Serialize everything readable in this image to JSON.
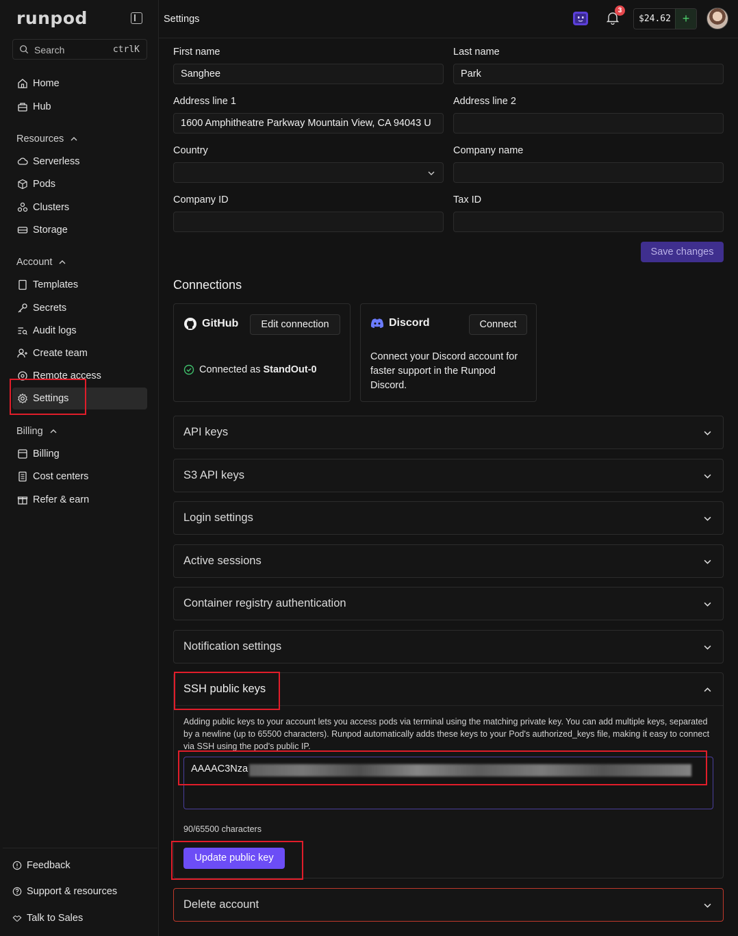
{
  "app": {
    "logo": "runpod",
    "page_title": "Settings"
  },
  "search": {
    "placeholder": "Search",
    "shortcut": "ctrlK"
  },
  "sidebar": {
    "top_items": [
      {
        "label": "Home",
        "icon": "home-icon"
      },
      {
        "label": "Hub",
        "icon": "hub-icon"
      }
    ],
    "sections": [
      {
        "label": "Resources",
        "items": [
          "Serverless",
          "Pods",
          "Clusters",
          "Storage"
        ]
      },
      {
        "label": "Account",
        "items": [
          "Templates",
          "Secrets",
          "Audit logs",
          "Create team",
          "Remote access",
          "Settings"
        ]
      },
      {
        "label": "Billing",
        "items": [
          "Billing",
          "Cost centers",
          "Refer & earn"
        ]
      }
    ],
    "footer": [
      "Feedback",
      "Support & resources",
      "Talk to Sales"
    ]
  },
  "header": {
    "notifications_count": "3",
    "balance": "$24.62",
    "add_label": "+"
  },
  "profile": {
    "first_name_label": "First name",
    "first_name": "Sanghee",
    "last_name_label": "Last name",
    "last_name": "Park",
    "address1_label": "Address line 1",
    "address1": "1600 Amphitheatre Parkway Mountain View, CA 94043 U",
    "address2_label": "Address line 2",
    "address2": "",
    "country_label": "Country",
    "country": "",
    "company_name_label": "Company name",
    "company_name": "",
    "company_id_label": "Company ID",
    "company_id": "",
    "tax_id_label": "Tax ID",
    "tax_id": "",
    "save_label": "Save changes"
  },
  "connections": {
    "title": "Connections",
    "github": {
      "name": "GitHub",
      "button": "Edit connection",
      "status_prefix": "Connected as",
      "username": "StandOut-0"
    },
    "discord": {
      "name": "Discord",
      "button": "Connect",
      "description": "Connect your Discord account for faster support in the Runpod Discord."
    }
  },
  "accordions": [
    "API keys",
    "S3 API keys",
    "Login settings",
    "Active sessions",
    "Container registry authentication",
    "Notification settings"
  ],
  "ssh": {
    "title": "SSH public keys",
    "description": "Adding public keys to your account lets you access pods via terminal using the matching private key. You can add multiple keys, separated by a newline (up to 65500 characters). Runpod automatically adds these keys to your Pod's authorized_keys file, making it easy to connect via SSH using the pod's public IP.",
    "key_prefix": "AAAAC3Nza",
    "char_count": "90/65500 characters",
    "button": "Update public key"
  },
  "delete_account": {
    "label": "Delete account"
  },
  "colors": {
    "accent": "#6c4df6",
    "highlight": "#e11d2a",
    "danger": "#c0392b",
    "success": "#3fbf6b"
  }
}
